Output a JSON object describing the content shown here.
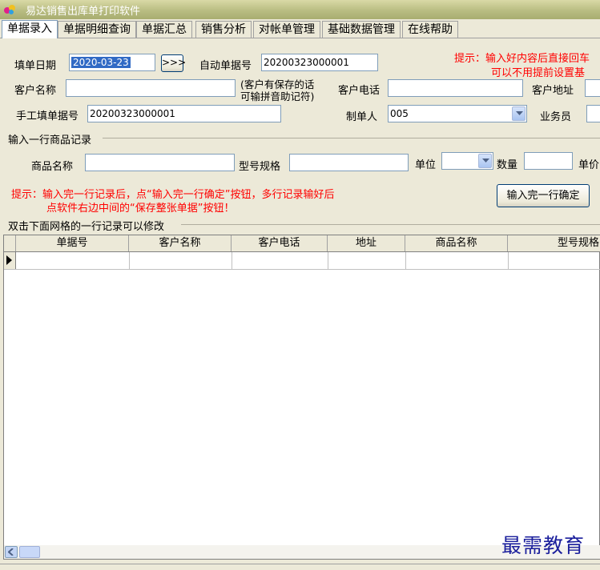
{
  "window": {
    "title": "易达销售出库单打印软件"
  },
  "tabs": [
    {
      "label": "单据录入",
      "active": true
    },
    {
      "label": "单据明细查询"
    },
    {
      "label": "单据汇总"
    },
    {
      "label": "销售分析"
    },
    {
      "label": "对帐单管理"
    },
    {
      "label": "基础数据管理"
    },
    {
      "label": "在线帮助"
    }
  ],
  "form": {
    "date_label": "填单日期",
    "date_value": "2020-03-23",
    "date_button": ">>>",
    "auto_no_label": "自动单据号",
    "auto_no_value": "20200323000001",
    "tip_line1": "提示：输入好内容后直接回车",
    "tip_line2": "可以不用提前设置基",
    "customer_label": "客户名称",
    "customer_value": "",
    "pinyin_hint_line1": "(客户有保存的话",
    "pinyin_hint_line2": "可输拼音助记符)",
    "phone_label": "客户电话",
    "phone_value": "",
    "address_label": "客户地址",
    "manual_no_label": "手工填单据号",
    "manual_no_value": "20200323000001",
    "maker_label": "制单人",
    "maker_value": "005",
    "salesman_label": "业务员"
  },
  "item_group": {
    "title": "输入一行商品记录",
    "product_label": "商品名称",
    "spec_label": "型号规格",
    "unit_label": "单位",
    "qty_label": "数量",
    "price_label": "单价",
    "tip_line1": "提示：输入完一行记录后，点“输入完一行确定”按钮，多行记录输好后",
    "tip_line2": "点软件右边中间的“保存整张单据”按钮！",
    "confirm_button": "输入完一行确定"
  },
  "grid": {
    "title": "双击下面网格的一行记录可以修改",
    "columns": [
      "单据号",
      "客户名称",
      "客户电话",
      "地址",
      "商品名称",
      "型号规格"
    ]
  },
  "watermark": "最需教育"
}
